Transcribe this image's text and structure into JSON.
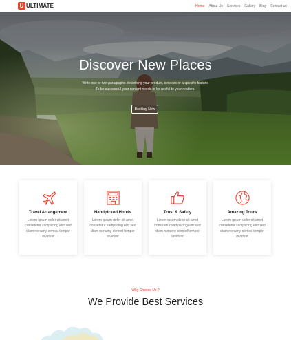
{
  "brand": {
    "mark": "U",
    "name": "ULTIMATE",
    "accent": "#e8412c"
  },
  "nav": {
    "items": [
      "Home",
      "About Us",
      "Services",
      "Gallery",
      "Blog",
      "Contact us"
    ],
    "active_index": 0
  },
  "hero": {
    "title": "Discover New Places",
    "text_line1": "Write one or two paragraphs describing your product, services or a specific feature.",
    "text_line2": "To be successful your content needs to be useful to your readers.",
    "button": "Booking Now"
  },
  "features": [
    {
      "icon": "airplane-icon",
      "title": "Travel Arrangement",
      "desc": [
        "Lorem ipsum dolor sit amet",
        "consetetur sadipscing elitr sed",
        "diam nonumy eirmod tempor",
        "invidunt"
      ]
    },
    {
      "icon": "hotel-icon",
      "title": "Handpicked Hotels",
      "desc": [
        "Lorem ipsum dolor sit amet",
        "consetetur sadipscing elitr sed",
        "diam nonumy eirmod tempor",
        "invidunt"
      ]
    },
    {
      "icon": "thumbs-up-icon",
      "title": "Trust & Safety",
      "desc": [
        "Lorem ipsum dolor sit amet",
        "consetetur sadipscing elitr sed",
        "diam nonumy eirmod tempor",
        "invidunt"
      ]
    },
    {
      "icon": "globe-icon",
      "title": "Amazing Tours",
      "desc": [
        "Lorem ipsum dolor sit amet",
        "consetetur sadipscing elitr sed",
        "diam nonumy eirmod tempor",
        "invidunt"
      ]
    }
  ],
  "why": {
    "kicker": "Why Choose Us ?",
    "title": "We Provide Best Services"
  }
}
